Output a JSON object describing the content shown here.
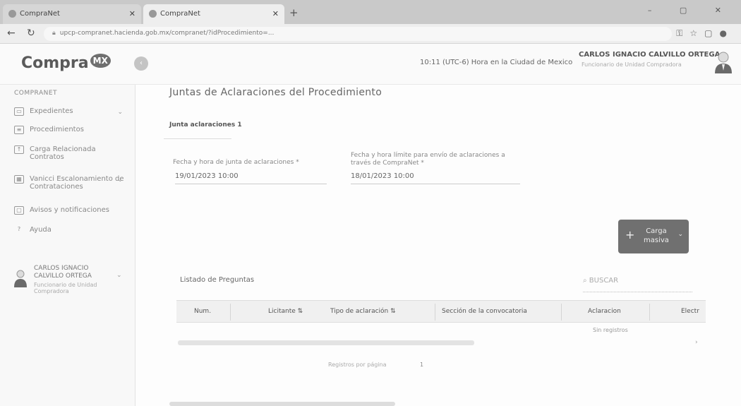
{
  "browser": {
    "tabs": [
      {
        "label": "CompraNet"
      },
      {
        "label": "CompraNet"
      }
    ],
    "new_tab": "+",
    "url": "upcp-compranet.hacienda.gob.mx/compranet/?idProcedimiento=...",
    "window_controls": "– ▢ ✕"
  },
  "header": {
    "logo_text": "Compra",
    "logo_badge": "MX",
    "collapse_icon": "chevron-left",
    "time_text": "10:11 (UTC-6) Hora en la Ciudad de Mexico",
    "user_name": "CARLOS IGNACIO CALVILLO ORTEGA",
    "user_role": "Funcionario de Unidad Compradora"
  },
  "sidebar": {
    "title": "COMPRANET",
    "items": [
      {
        "label": "Expedientes",
        "icon": "folder-icon",
        "has_chevron": true
      },
      {
        "label": "Procedimientos",
        "icon": "list-icon",
        "has_chevron": false
      },
      {
        "label": "Carga Relacionada Contratos",
        "icon": "upload-icon",
        "has_chevron": false
      },
      {
        "label": "Vanicci Escalonamiento de Contrataciones",
        "icon": "table-icon",
        "has_chevron": true
      },
      {
        "label": "Avisos y notificaciones",
        "icon": "bell-icon",
        "has_chevron": false
      },
      {
        "label": "Ayuda",
        "icon": "help-icon",
        "has_chevron": false
      }
    ],
    "user": {
      "name": "CARLOS IGNACIO CALVILLO ORTEGA",
      "role": "Funcionario de Unidad Compradora"
    }
  },
  "main": {
    "title": "Juntas de Aclaraciones del Procedimiento",
    "tab_label": "Junta aclaraciones 1",
    "fields": [
      {
        "label": "Fecha y hora de junta de aclaraciones *",
        "value": "19/01/2023 10:00"
      },
      {
        "label": "Fecha y hora límite para envío de aclaraciones a través de CompraNet *",
        "value": "18/01/2023 10:00"
      }
    ],
    "carga_button": {
      "plus": "+",
      "label_line1": "Carga",
      "label_line2": "masiva",
      "dropdown": "⌄"
    },
    "list_title": "Listado de Preguntas",
    "search_placeholder": "BUSCAR",
    "table": {
      "columns": [
        "Num.",
        "Licitante",
        "Tipo de aclaración",
        "Sección de la convocatoria",
        "Aclaracion",
        "Electr"
      ],
      "empty_text": "Sin registros"
    },
    "paginator_text": "Registros por página",
    "page_number": "1"
  },
  "colors": {
    "button_gray": "#707070",
    "sidebar_bg": "#f8f8f8",
    "table_header_bg": "#f0f0f0"
  }
}
